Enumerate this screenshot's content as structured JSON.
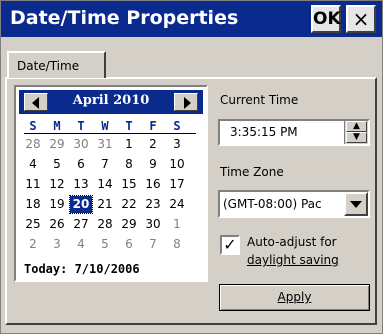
{
  "window": {
    "title": "Date/Time Properties",
    "ok_label": "OK",
    "close_label": "×"
  },
  "tabs": [
    {
      "label": "Date/Time",
      "active": true
    }
  ],
  "calendar": {
    "month_label": "April 2010",
    "days_of_week": [
      "S",
      "M",
      "T",
      "W",
      "T",
      "F",
      "S"
    ],
    "weeks": [
      [
        "28",
        "29",
        "30",
        "31",
        "1",
        "2",
        "3"
      ],
      [
        "4",
        "5",
        "6",
        "7",
        "8",
        "9",
        "10"
      ],
      [
        "11",
        "12",
        "13",
        "14",
        "15",
        "16",
        "17"
      ],
      [
        "18",
        "19",
        "20",
        "21",
        "22",
        "23",
        "24"
      ],
      [
        "25",
        "26",
        "27",
        "28",
        "29",
        "30",
        "1"
      ],
      [
        "2",
        "3",
        "4",
        "5",
        "6",
        "7",
        "8"
      ]
    ],
    "selected_day": "20",
    "today_label": "Today: 7/10/2006"
  },
  "current_time": {
    "label": "Current Time",
    "value": "3:35:15 PM"
  },
  "time_zone": {
    "label": "Time Zone",
    "value": "(GMT-08:00) Pac"
  },
  "daylight": {
    "label_line1": "Auto-adjust for",
    "label_line2": "daylight saving",
    "checked": true,
    "check_glyph": "✓"
  },
  "apply_label": "Apply",
  "colors": {
    "titlebar": "#0a2a8e",
    "face": "#d4d0c8",
    "calendar_header": "#0a2a8e",
    "selection": "#0a2a8e"
  }
}
